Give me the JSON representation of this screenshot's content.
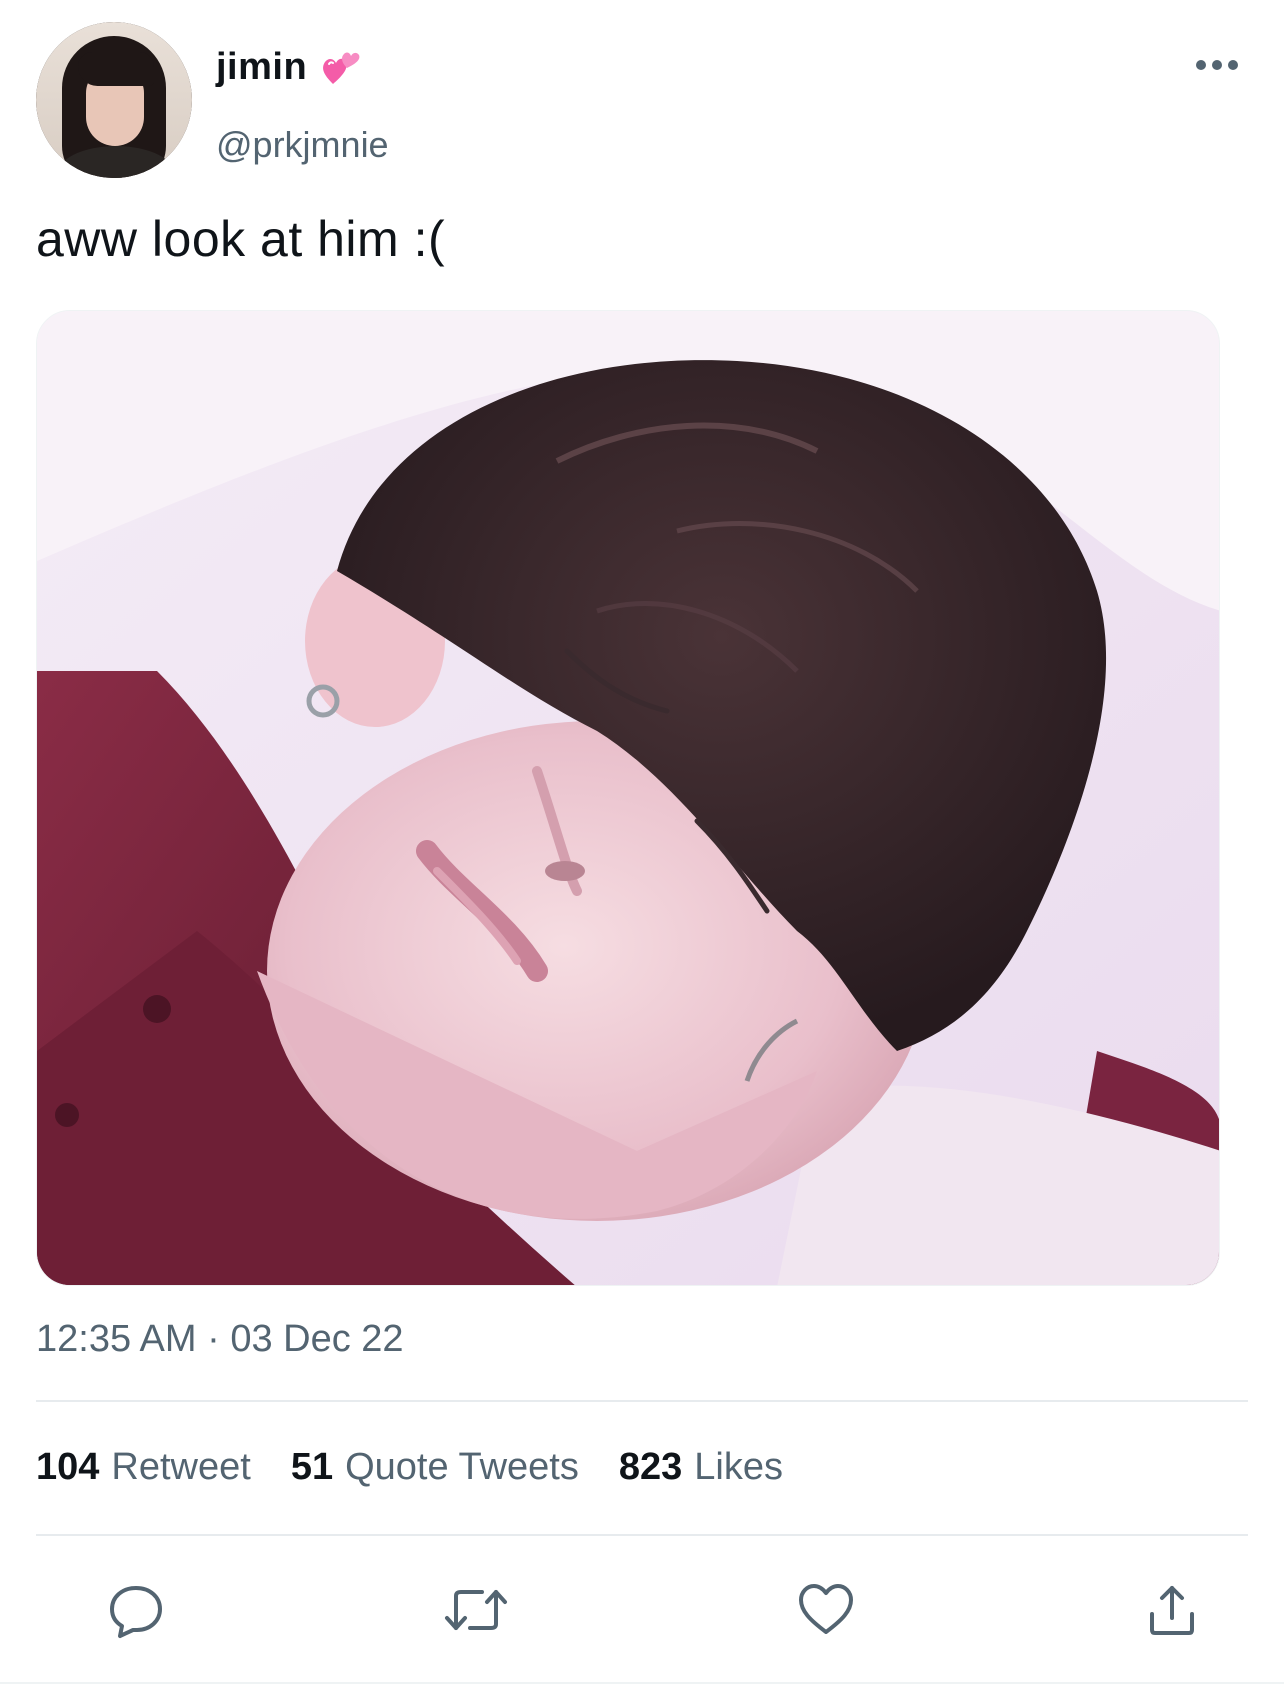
{
  "tweet": {
    "author": {
      "display_name": "jimin",
      "name_emoji": "two-hearts-emoji",
      "handle": "@prkjmnie"
    },
    "text": "aww look at him :(",
    "timestamp": "12:35 AM · 03 Dec 22",
    "stats": {
      "retweets_count": "104",
      "retweets_label": "Retweet",
      "quotes_count": "51",
      "quotes_label": "Quote Tweets",
      "likes_count": "823",
      "likes_label": "Likes"
    },
    "actions": [
      "reply-icon",
      "retweet-icon",
      "like-icon",
      "share-icon"
    ]
  },
  "colors": {
    "text_primary": "#0f1419",
    "text_secondary": "#536471",
    "divider": "#e7ebee",
    "emoji_heart": "#f45ca8"
  }
}
